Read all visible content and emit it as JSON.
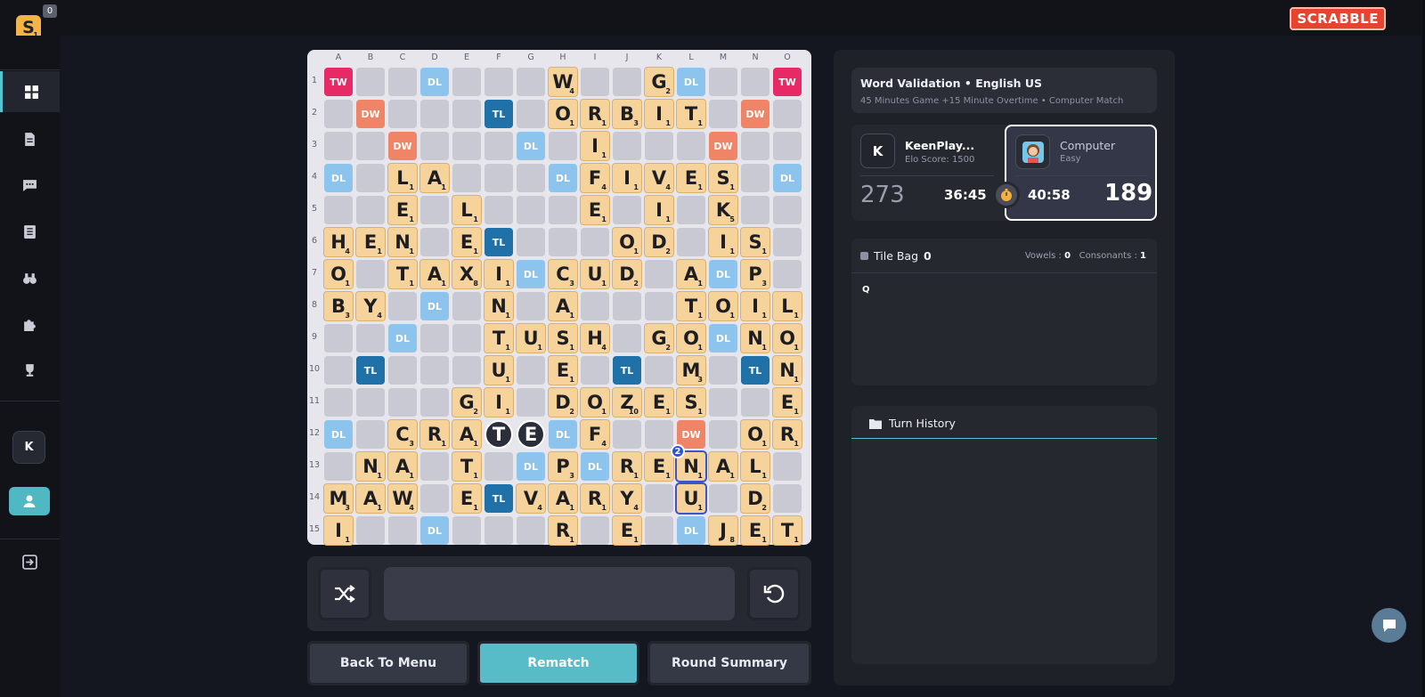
{
  "app": {
    "logo_letter": "S",
    "logo_points": "1",
    "notification_count": "0",
    "brand": "SCRABBLE",
    "avatar_initial": "K"
  },
  "sidebar": {
    "items": [
      {
        "icon": "dashboard-icon"
      },
      {
        "icon": "document-icon"
      },
      {
        "icon": "chat-icon"
      },
      {
        "icon": "notebook-icon"
      },
      {
        "icon": "binoculars-icon"
      },
      {
        "icon": "puzzle-icon"
      },
      {
        "icon": "trophy-icon"
      }
    ]
  },
  "board": {
    "columns": [
      "A",
      "B",
      "C",
      "D",
      "E",
      "F",
      "G",
      "H",
      "I",
      "J",
      "K",
      "L",
      "M",
      "N",
      "O"
    ],
    "rows": [
      "1",
      "2",
      "3",
      "4",
      "5",
      "6",
      "7",
      "8",
      "9",
      "10",
      "11",
      "12",
      "13",
      "14",
      "15"
    ],
    "premiums": [
      {
        "r": 0,
        "c": 0,
        "t": "TW"
      },
      {
        "r": 0,
        "c": 3,
        "t": "DL"
      },
      {
        "r": 0,
        "c": 11,
        "t": "DL"
      },
      {
        "r": 0,
        "c": 14,
        "t": "TW"
      },
      {
        "r": 1,
        "c": 1,
        "t": "DW"
      },
      {
        "r": 1,
        "c": 5,
        "t": "TL"
      },
      {
        "r": 1,
        "c": 13,
        "t": "DW"
      },
      {
        "r": 2,
        "c": 2,
        "t": "DW"
      },
      {
        "r": 2,
        "c": 6,
        "t": "DL"
      },
      {
        "r": 2,
        "c": 12,
        "t": "DW"
      },
      {
        "r": 3,
        "c": 0,
        "t": "DL"
      },
      {
        "r": 3,
        "c": 7,
        "t": "DL"
      },
      {
        "r": 3,
        "c": 14,
        "t": "DL"
      },
      {
        "r": 5,
        "c": 5,
        "t": "TL"
      },
      {
        "r": 6,
        "c": 6,
        "t": "DL"
      },
      {
        "r": 6,
        "c": 12,
        "t": "DL"
      },
      {
        "r": 7,
        "c": 3,
        "t": "DL"
      },
      {
        "r": 8,
        "c": 2,
        "t": "DL"
      },
      {
        "r": 8,
        "c": 12,
        "t": "DL"
      },
      {
        "r": 9,
        "c": 1,
        "t": "TL"
      },
      {
        "r": 9,
        "c": 9,
        "t": "TL"
      },
      {
        "r": 9,
        "c": 13,
        "t": "TL"
      },
      {
        "r": 11,
        "c": 0,
        "t": "DL"
      },
      {
        "r": 11,
        "c": 7,
        "t": "DL"
      },
      {
        "r": 11,
        "c": 11,
        "t": "DW"
      },
      {
        "r": 12,
        "c": 6,
        "t": "DL"
      },
      {
        "r": 12,
        "c": 8,
        "t": "DL"
      },
      {
        "r": 13,
        "c": 5,
        "t": "TL"
      },
      {
        "r": 14,
        "c": 3,
        "t": "DL"
      },
      {
        "r": 14,
        "c": 11,
        "t": "DL"
      }
    ],
    "tiles": [
      {
        "r": 0,
        "c": 7,
        "l": "W",
        "p": "4"
      },
      {
        "r": 0,
        "c": 10,
        "l": "G",
        "p": "2"
      },
      {
        "r": 1,
        "c": 7,
        "l": "O",
        "p": "1"
      },
      {
        "r": 1,
        "c": 8,
        "l": "R",
        "p": "1"
      },
      {
        "r": 1,
        "c": 9,
        "l": "B",
        "p": "3"
      },
      {
        "r": 1,
        "c": 10,
        "l": "I",
        "p": "1"
      },
      {
        "r": 1,
        "c": 11,
        "l": "T",
        "p": "1"
      },
      {
        "r": 2,
        "c": 8,
        "l": "I",
        "p": "1"
      },
      {
        "r": 3,
        "c": 2,
        "l": "L",
        "p": "1"
      },
      {
        "r": 3,
        "c": 3,
        "l": "A",
        "p": "1"
      },
      {
        "r": 3,
        "c": 8,
        "l": "F",
        "p": "4"
      },
      {
        "r": 3,
        "c": 9,
        "l": "I",
        "p": "1"
      },
      {
        "r": 3,
        "c": 10,
        "l": "V",
        "p": "4"
      },
      {
        "r": 3,
        "c": 11,
        "l": "E",
        "p": "1"
      },
      {
        "r": 3,
        "c": 12,
        "l": "S",
        "p": "1"
      },
      {
        "r": 4,
        "c": 2,
        "l": "E",
        "p": "1"
      },
      {
        "r": 4,
        "c": 4,
        "l": "L",
        "p": "1"
      },
      {
        "r": 4,
        "c": 8,
        "l": "E",
        "p": "1"
      },
      {
        "r": 4,
        "c": 10,
        "l": "I",
        "p": "1"
      },
      {
        "r": 4,
        "c": 12,
        "l": "K",
        "p": "5"
      },
      {
        "r": 5,
        "c": 0,
        "l": "H",
        "p": "4"
      },
      {
        "r": 5,
        "c": 1,
        "l": "E",
        "p": "1"
      },
      {
        "r": 5,
        "c": 2,
        "l": "N",
        "p": "1"
      },
      {
        "r": 5,
        "c": 4,
        "l": "E",
        "p": "1"
      },
      {
        "r": 5,
        "c": 9,
        "l": "O",
        "p": "1"
      },
      {
        "r": 5,
        "c": 10,
        "l": "D",
        "p": "2"
      },
      {
        "r": 5,
        "c": 12,
        "l": "I",
        "p": "1"
      },
      {
        "r": 5,
        "c": 13,
        "l": "S",
        "p": "1"
      },
      {
        "r": 6,
        "c": 0,
        "l": "O",
        "p": "1"
      },
      {
        "r": 6,
        "c": 2,
        "l": "T",
        "p": "1"
      },
      {
        "r": 6,
        "c": 3,
        "l": "A",
        "p": "1"
      },
      {
        "r": 6,
        "c": 4,
        "l": "X",
        "p": "8"
      },
      {
        "r": 6,
        "c": 5,
        "l": "I",
        "p": "1"
      },
      {
        "r": 6,
        "c": 7,
        "l": "C",
        "p": "3"
      },
      {
        "r": 6,
        "c": 8,
        "l": "U",
        "p": "1"
      },
      {
        "r": 6,
        "c": 9,
        "l": "D",
        "p": "2"
      },
      {
        "r": 6,
        "c": 11,
        "l": "A",
        "p": "1"
      },
      {
        "r": 6,
        "c": 13,
        "l": "P",
        "p": "3"
      },
      {
        "r": 7,
        "c": 0,
        "l": "B",
        "p": "3"
      },
      {
        "r": 7,
        "c": 1,
        "l": "Y",
        "p": "4"
      },
      {
        "r": 7,
        "c": 5,
        "l": "N",
        "p": "1"
      },
      {
        "r": 7,
        "c": 7,
        "l": "A",
        "p": "1"
      },
      {
        "r": 7,
        "c": 11,
        "l": "T",
        "p": "1"
      },
      {
        "r": 7,
        "c": 12,
        "l": "O",
        "p": "1"
      },
      {
        "r": 7,
        "c": 13,
        "l": "I",
        "p": "1"
      },
      {
        "r": 7,
        "c": 14,
        "l": "L",
        "p": "1"
      },
      {
        "r": 8,
        "c": 5,
        "l": "T",
        "p": "1"
      },
      {
        "r": 8,
        "c": 6,
        "l": "U",
        "p": "1"
      },
      {
        "r": 8,
        "c": 7,
        "l": "S",
        "p": "1"
      },
      {
        "r": 8,
        "c": 8,
        "l": "H",
        "p": "4"
      },
      {
        "r": 8,
        "c": 10,
        "l": "G",
        "p": "2"
      },
      {
        "r": 8,
        "c": 11,
        "l": "O",
        "p": "1"
      },
      {
        "r": 8,
        "c": 13,
        "l": "N",
        "p": "1"
      },
      {
        "r": 8,
        "c": 14,
        "l": "O",
        "p": "1"
      },
      {
        "r": 9,
        "c": 5,
        "l": "U",
        "p": "1"
      },
      {
        "r": 9,
        "c": 7,
        "l": "E",
        "p": "1"
      },
      {
        "r": 9,
        "c": 11,
        "l": "M",
        "p": "3"
      },
      {
        "r": 9,
        "c": 14,
        "l": "N",
        "p": "1"
      },
      {
        "r": 10,
        "c": 4,
        "l": "G",
        "p": "2"
      },
      {
        "r": 10,
        "c": 5,
        "l": "I",
        "p": "1"
      },
      {
        "r": 10,
        "c": 7,
        "l": "D",
        "p": "2"
      },
      {
        "r": 10,
        "c": 8,
        "l": "O",
        "p": "1"
      },
      {
        "r": 10,
        "c": 9,
        "l": "Z",
        "p": "10"
      },
      {
        "r": 10,
        "c": 10,
        "l": "E",
        "p": "1"
      },
      {
        "r": 10,
        "c": 11,
        "l": "S",
        "p": "1"
      },
      {
        "r": 10,
        "c": 14,
        "l": "E",
        "p": "1"
      },
      {
        "r": 11,
        "c": 2,
        "l": "C",
        "p": "3"
      },
      {
        "r": 11,
        "c": 3,
        "l": "R",
        "p": "1"
      },
      {
        "r": 11,
        "c": 4,
        "l": "A",
        "p": "1"
      },
      {
        "r": 11,
        "c": 5,
        "l": "T",
        "p": "",
        "blank": true
      },
      {
        "r": 11,
        "c": 6,
        "l": "E",
        "p": "",
        "blank": true
      },
      {
        "r": 11,
        "c": 8,
        "l": "F",
        "p": "4"
      },
      {
        "r": 11,
        "c": 13,
        "l": "O",
        "p": "1"
      },
      {
        "r": 11,
        "c": 14,
        "l": "R",
        "p": "1"
      },
      {
        "r": 12,
        "c": 1,
        "l": "N",
        "p": "1"
      },
      {
        "r": 12,
        "c": 2,
        "l": "A",
        "p": "1"
      },
      {
        "r": 12,
        "c": 4,
        "l": "T",
        "p": "1"
      },
      {
        "r": 12,
        "c": 7,
        "l": "P",
        "p": "3"
      },
      {
        "r": 12,
        "c": 9,
        "l": "R",
        "p": "1"
      },
      {
        "r": 12,
        "c": 10,
        "l": "E",
        "p": "1"
      },
      {
        "r": 12,
        "c": 11,
        "l": "N",
        "p": "1",
        "recent": true
      },
      {
        "r": 12,
        "c": 12,
        "l": "A",
        "p": "1"
      },
      {
        "r": 12,
        "c": 13,
        "l": "L",
        "p": "1"
      },
      {
        "r": 13,
        "c": 0,
        "l": "M",
        "p": "3"
      },
      {
        "r": 13,
        "c": 1,
        "l": "A",
        "p": "1"
      },
      {
        "r": 13,
        "c": 2,
        "l": "W",
        "p": "4"
      },
      {
        "r": 13,
        "c": 4,
        "l": "E",
        "p": "1"
      },
      {
        "r": 13,
        "c": 6,
        "l": "V",
        "p": "4"
      },
      {
        "r": 13,
        "c": 7,
        "l": "A",
        "p": "1"
      },
      {
        "r": 13,
        "c": 8,
        "l": "R",
        "p": "1"
      },
      {
        "r": 13,
        "c": 9,
        "l": "Y",
        "p": "4"
      },
      {
        "r": 13,
        "c": 11,
        "l": "U",
        "p": "1",
        "recent": true
      },
      {
        "r": 13,
        "c": 13,
        "l": "D",
        "p": "2"
      },
      {
        "r": 14,
        "c": 0,
        "l": "I",
        "p": "1"
      },
      {
        "r": 14,
        "c": 7,
        "l": "R",
        "p": "1"
      },
      {
        "r": 14,
        "c": 9,
        "l": "E",
        "p": "1"
      },
      {
        "r": 14,
        "c": 12,
        "l": "J",
        "p": "8"
      },
      {
        "r": 14,
        "c": 13,
        "l": "E",
        "p": "1"
      },
      {
        "r": 14,
        "c": 14,
        "l": "T",
        "p": "1"
      }
    ],
    "last_move_badge": "2"
  },
  "actions": {
    "back_label": "Back To Menu",
    "rematch_label": "Rematch",
    "summary_label": "Round Summary"
  },
  "game_info": {
    "title": "Word Validation",
    "language": "English US",
    "subtitle": "45 Minutes Game +15 Minute Overtime • Computer Match"
  },
  "players": {
    "left": {
      "initial": "K",
      "name": "KeenPlay...",
      "sub": "Elo Score: 1500",
      "score": "273",
      "time": "36:45"
    },
    "right": {
      "name": "Computer",
      "sub": "Easy",
      "score": "189",
      "time": "40:58"
    }
  },
  "tile_bag": {
    "label": "Tile Bag",
    "count": "0",
    "vowels_label": "Vowels :",
    "vowels": "0",
    "consonants_label": "Consonants :",
    "consonants": "1",
    "remaining": "Q"
  },
  "turn_history": {
    "label": "Turn History"
  },
  "colors": {
    "accent": "#57bcc7",
    "tile": "#f6d39a",
    "tw": "#e72a66",
    "dw": "#f08467",
    "tl": "#1f71a8",
    "dl": "#8cc4ee"
  }
}
